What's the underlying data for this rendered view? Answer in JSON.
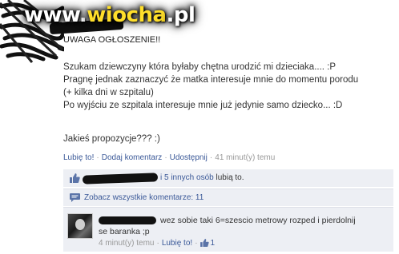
{
  "watermark": {
    "prefix": "www.",
    "brand": "wiocha",
    "suffix": ".pl"
  },
  "post": {
    "title": "UWAGA OGŁOSZENIE!!",
    "lines": [
      "Szukam dziewczyny która byłaby chętna urodzić mi dzieciaka.... :P",
      "Pragnę jednak zaznaczyć że matka interesuje mnie do momentu porodu",
      "(+ kilka dni w szpitalu)",
      "Po wyjściu ze szpitala interesuje mnie już jedynie samo dziecko... :D"
    ],
    "question": "Jakieś propozycje??? :)"
  },
  "actions": {
    "like": "Lubię to!",
    "comment": "Dodaj komentarz",
    "share": "Udostępnij",
    "time": "41 minut(y) temu"
  },
  "likes": {
    "others_link": "i 5 innych osób",
    "suffix": " lubią to."
  },
  "comments": {
    "view_all": "Zobacz wszystkie komentarze: 11"
  },
  "comment": {
    "line1": "wez sobie taki 6=szescio metrowy rozped i pierdolnij",
    "line2": "se baranka ;p",
    "time": "4 minut(y) temu",
    "like": "Lubię to!",
    "like_count": "1"
  },
  "colors": {
    "link": "#3b5998",
    "muted": "#999999",
    "panel": "#edeff4"
  },
  "icons": [
    "like-thumb-icon",
    "comment-bubble-icon",
    "avatar-image"
  ]
}
